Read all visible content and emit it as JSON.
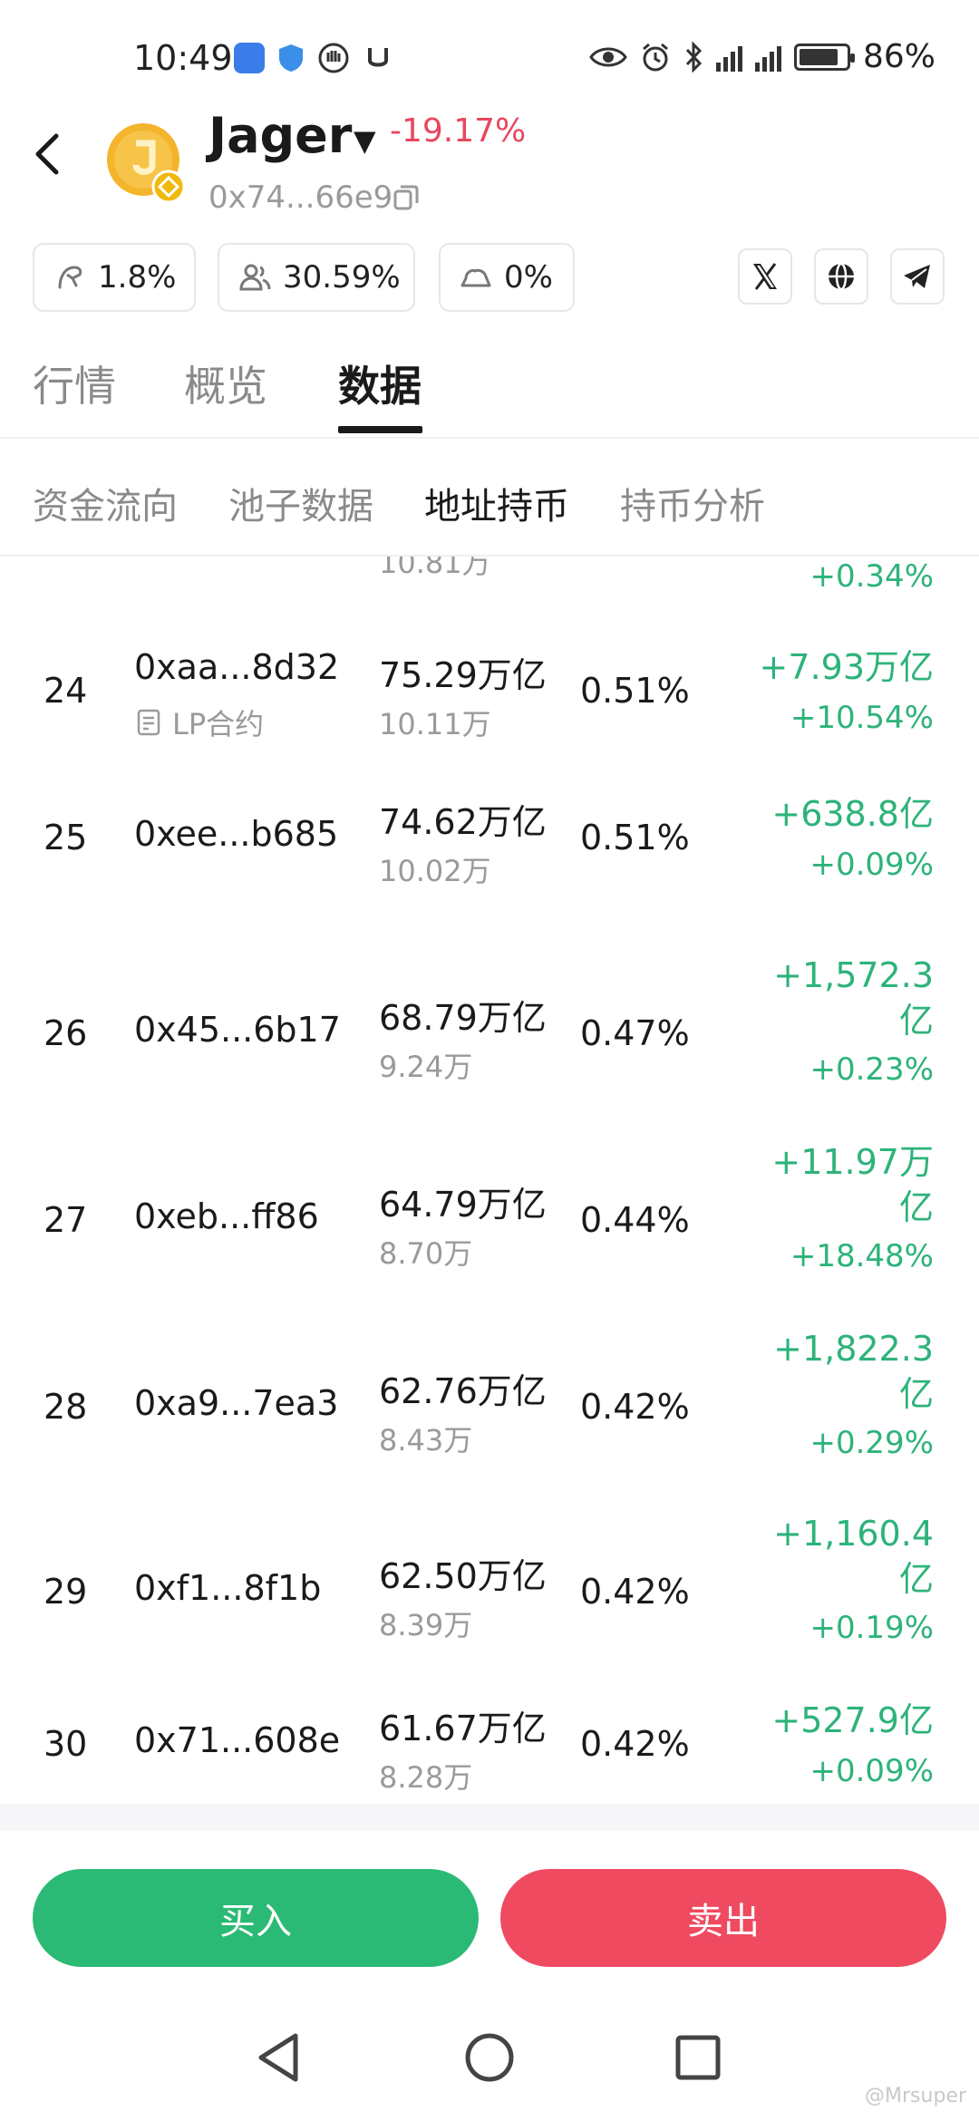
{
  "status_bar": {
    "time": "10:49",
    "battery": "86%",
    "battery_level": 0.86
  },
  "header": {
    "token_name": "Jager",
    "change_arrow": "▼",
    "change": "-19.17%",
    "address": "0x74...66e9"
  },
  "stats": {
    "stat1": "1.8%",
    "stat2": "30.59%",
    "stat3": "0%"
  },
  "main_tabs": [
    "行情",
    "概览",
    "数据"
  ],
  "sub_tabs": [
    "资金流向",
    "池子数据",
    "地址持币",
    "持币分析"
  ],
  "table": {
    "cut_row": {
      "qty": "10.81万",
      "change_pct": "+0.34%"
    },
    "rows": [
      {
        "rank": "24",
        "address": "0xaa...8d32",
        "tag": "LP合约",
        "amount": "75.29万亿",
        "qty": "10.11万",
        "share": "0.51%",
        "change_line1": "+7.93万亿",
        "change_line2": "",
        "change_pct": "+10.54%"
      },
      {
        "rank": "25",
        "address": "0xee...b685",
        "tag": "",
        "amount": "74.62万亿",
        "qty": "10.02万",
        "share": "0.51%",
        "change_line1": "+638.8亿",
        "change_line2": "",
        "change_pct": "+0.09%"
      },
      {
        "rank": "26",
        "address": "0x45...6b17",
        "tag": "",
        "amount": "68.79万亿",
        "qty": "9.24万",
        "share": "0.47%",
        "change_line1": "+1,572.3",
        "change_line2": "亿",
        "change_pct": "+0.23%"
      },
      {
        "rank": "27",
        "address": "0xeb...ff86",
        "tag": "",
        "amount": "64.79万亿",
        "qty": "8.70万",
        "share": "0.44%",
        "change_line1": "+11.97万",
        "change_line2": "亿",
        "change_pct": "+18.48%"
      },
      {
        "rank": "28",
        "address": "0xa9...7ea3",
        "tag": "",
        "amount": "62.76万亿",
        "qty": "8.43万",
        "share": "0.42%",
        "change_line1": "+1,822.3",
        "change_line2": "亿",
        "change_pct": "+0.29%"
      },
      {
        "rank": "29",
        "address": "0xf1...8f1b",
        "tag": "",
        "amount": "62.50万亿",
        "qty": "8.39万",
        "share": "0.42%",
        "change_line1": "+1,160.4",
        "change_line2": "亿",
        "change_pct": "+0.19%"
      },
      {
        "rank": "30",
        "address": "0x71...608e",
        "tag": "",
        "amount": "61.67万亿",
        "qty": "8.28万",
        "share": "0.42%",
        "change_line1": "+527.9亿",
        "change_line2": "",
        "change_pct": "+0.09%"
      }
    ]
  },
  "actions": {
    "buy": "买入",
    "sell": "卖出"
  },
  "watermark": "@Mrsuper",
  "colors": {
    "up": "#2db37a",
    "down": "#e8475f",
    "buy_button": "#2bba75",
    "sell_button": "#ef4a60"
  },
  "icons": [
    "back-arrow-icon",
    "copy-icon",
    "x-twitter-icon",
    "globe-icon",
    "telegram-icon",
    "lp-contract-icon"
  ]
}
